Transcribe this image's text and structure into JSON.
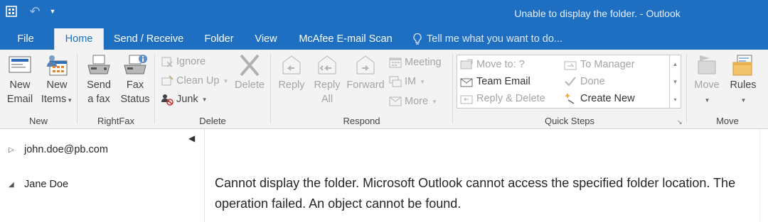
{
  "window": {
    "title": "Unable to display the folder. - Outlook"
  },
  "tabs": [
    {
      "label": "File",
      "active": false
    },
    {
      "label": "Home",
      "active": true
    },
    {
      "label": "Send / Receive",
      "active": false
    },
    {
      "label": "Folder",
      "active": false
    },
    {
      "label": "View",
      "active": false
    },
    {
      "label": "McAfee E-mail Scan",
      "active": false
    }
  ],
  "tell_me": {
    "placeholder": "Tell me what you want to do..."
  },
  "ribbon": {
    "new": {
      "label": "New",
      "new_email_1": "New",
      "new_email_2": "Email",
      "new_items_1": "New",
      "new_items_2": "Items"
    },
    "rightfax": {
      "label": "RightFax",
      "send_fax_1": "Send",
      "send_fax_2": "a fax",
      "fax_status_1": "Fax",
      "fax_status_2": "Status"
    },
    "delete": {
      "label": "Delete",
      "ignore": "Ignore",
      "clean_up": "Clean Up",
      "junk": "Junk",
      "delete": "Delete"
    },
    "respond": {
      "label": "Respond",
      "reply": "Reply",
      "reply_all_1": "Reply",
      "reply_all_2": "All",
      "forward": "Forward",
      "meeting": "Meeting",
      "im": "IM",
      "more": "More"
    },
    "quick_steps": {
      "label": "Quick Steps",
      "items": [
        "Move to: ?",
        "Team Email",
        "Reply & Delete",
        "To Manager",
        "Done",
        "Create New"
      ]
    },
    "move": {
      "label": "Move",
      "move": "Move",
      "rules": "Rules"
    }
  },
  "nav": {
    "accounts": [
      {
        "name": "john.doe@pb.com",
        "expanded": false
      },
      {
        "name": "Jane Doe",
        "expanded": true
      }
    ]
  },
  "content": {
    "message": "Cannot display the folder. Microsoft Outlook cannot access the specified folder location. The operation failed. An object cannot be found."
  },
  "colors": {
    "accent": "#1e6fc2",
    "ribbon_bg": "#f3f3f3",
    "disabled_text": "#a5a5a5"
  }
}
